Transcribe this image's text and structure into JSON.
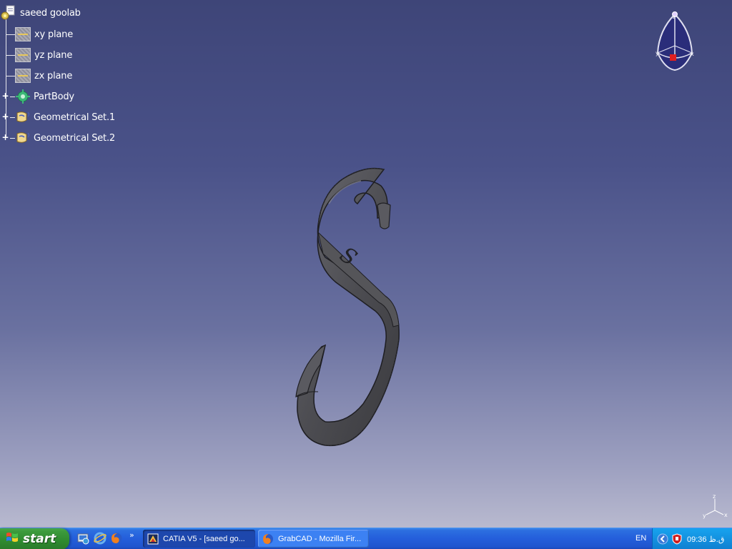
{
  "tree": {
    "root_label": "saeed goolab",
    "planes": [
      {
        "label": "xy plane"
      },
      {
        "label": "yz plane"
      },
      {
        "label": "zx plane"
      }
    ],
    "part_body": "PartBody",
    "geo_sets": [
      {
        "label": "Geometrical Set.1"
      },
      {
        "label": "Geometrical Set.2"
      }
    ]
  },
  "compass": {
    "x_label": "x",
    "y_label": "y",
    "z_label": "z"
  },
  "axis_triad": {
    "x_label": "x",
    "y_label": "y",
    "z_label": "z"
  },
  "hook": {
    "engraving": "S"
  },
  "taskbar": {
    "start_label": "start",
    "quick_launch": [
      "show-desktop-icon",
      "internet-explorer-icon",
      "firefox-icon"
    ],
    "more_label": "»",
    "tasks": [
      {
        "label": "CATIA V5 - [saeed go...",
        "icon": "catia-icon",
        "active": true
      },
      {
        "label": "GrabCAD - Mozilla Fir...",
        "icon": "firefox-icon",
        "active": false
      }
    ],
    "lang": "EN",
    "clock": "09:36 ق.ظ"
  },
  "colors": {
    "background_top": "#3e4578",
    "background_bottom": "#c0c1d3",
    "hook_fill": "#4d4d52",
    "taskbar_blue": "#245edb",
    "start_green": "#3c9a3c"
  }
}
